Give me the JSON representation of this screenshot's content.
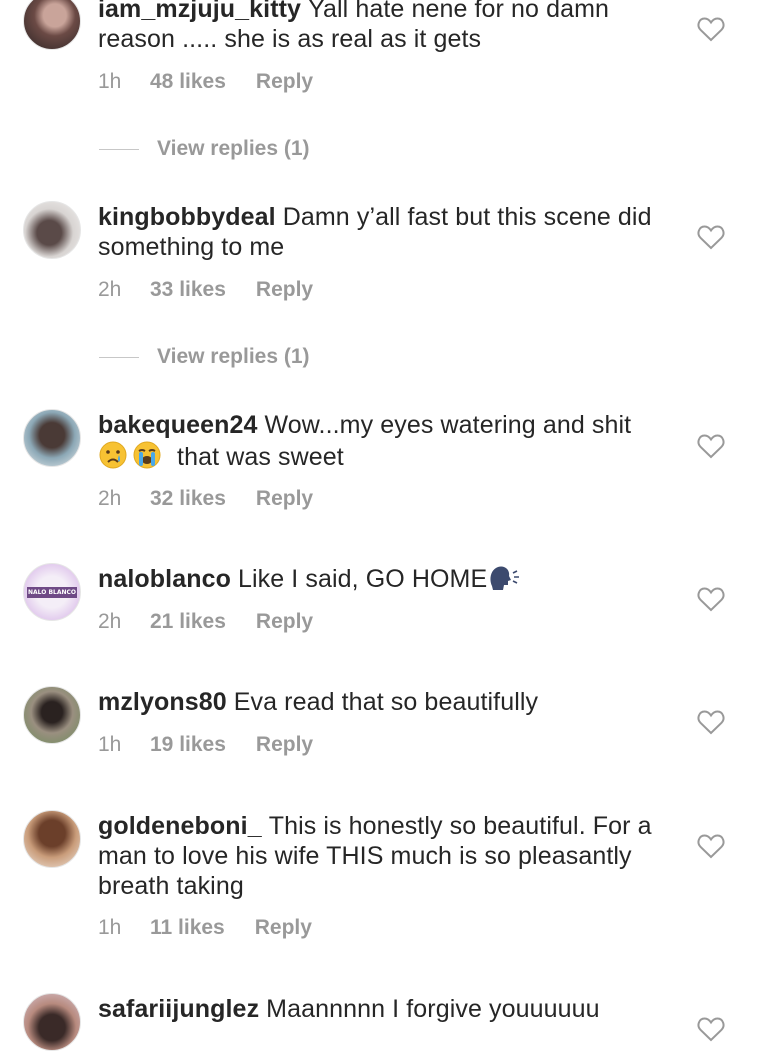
{
  "comments": [
    {
      "username": "iam_mzjuju_kitty",
      "text": "Yall hate nene for no damn reason ..... she is as real as it gets",
      "time": "1h",
      "likes": "48 likes",
      "reply": "Reply",
      "view_replies": "View replies (1)"
    },
    {
      "username": "kingbobbydeal",
      "text": "Damn y’all fast but this scene did something to me",
      "time": "2h",
      "likes": "33 likes",
      "reply": "Reply",
      "view_replies": "View replies (1)"
    },
    {
      "username": "bakequeen24",
      "text": "Wow...my eyes watering and shit",
      "text_after": "that was sweet",
      "time": "2h",
      "likes": "32 likes",
      "reply": "Reply"
    },
    {
      "username": "naloblanco",
      "text": "Like I said, GO HOME",
      "time": "2h",
      "likes": "21 likes",
      "reply": "Reply",
      "avatar_text": "NALO BLANCO"
    },
    {
      "username": "mzlyons80",
      "text": "Eva read that so beautifully",
      "time": "1h",
      "likes": "19 likes",
      "reply": "Reply"
    },
    {
      "username": "goldeneboni_",
      "text": "This is honestly so beautiful. For a man to love his wife THIS much is so pleasantly breath taking",
      "time": "1h",
      "likes": "11 likes",
      "reply": "Reply"
    },
    {
      "username": "safariijunglez",
      "text": "Maannnnn I forgive youuuuuu"
    }
  ],
  "icons": {
    "heart": "heart-outline-icon",
    "cry": "crying-face-emoji",
    "sob": "loudly-crying-face-emoji",
    "speaking": "speaking-head-emoji"
  },
  "colors": {
    "text": "#262626",
    "meta": "#999999",
    "divider": "#c7c7c7"
  }
}
